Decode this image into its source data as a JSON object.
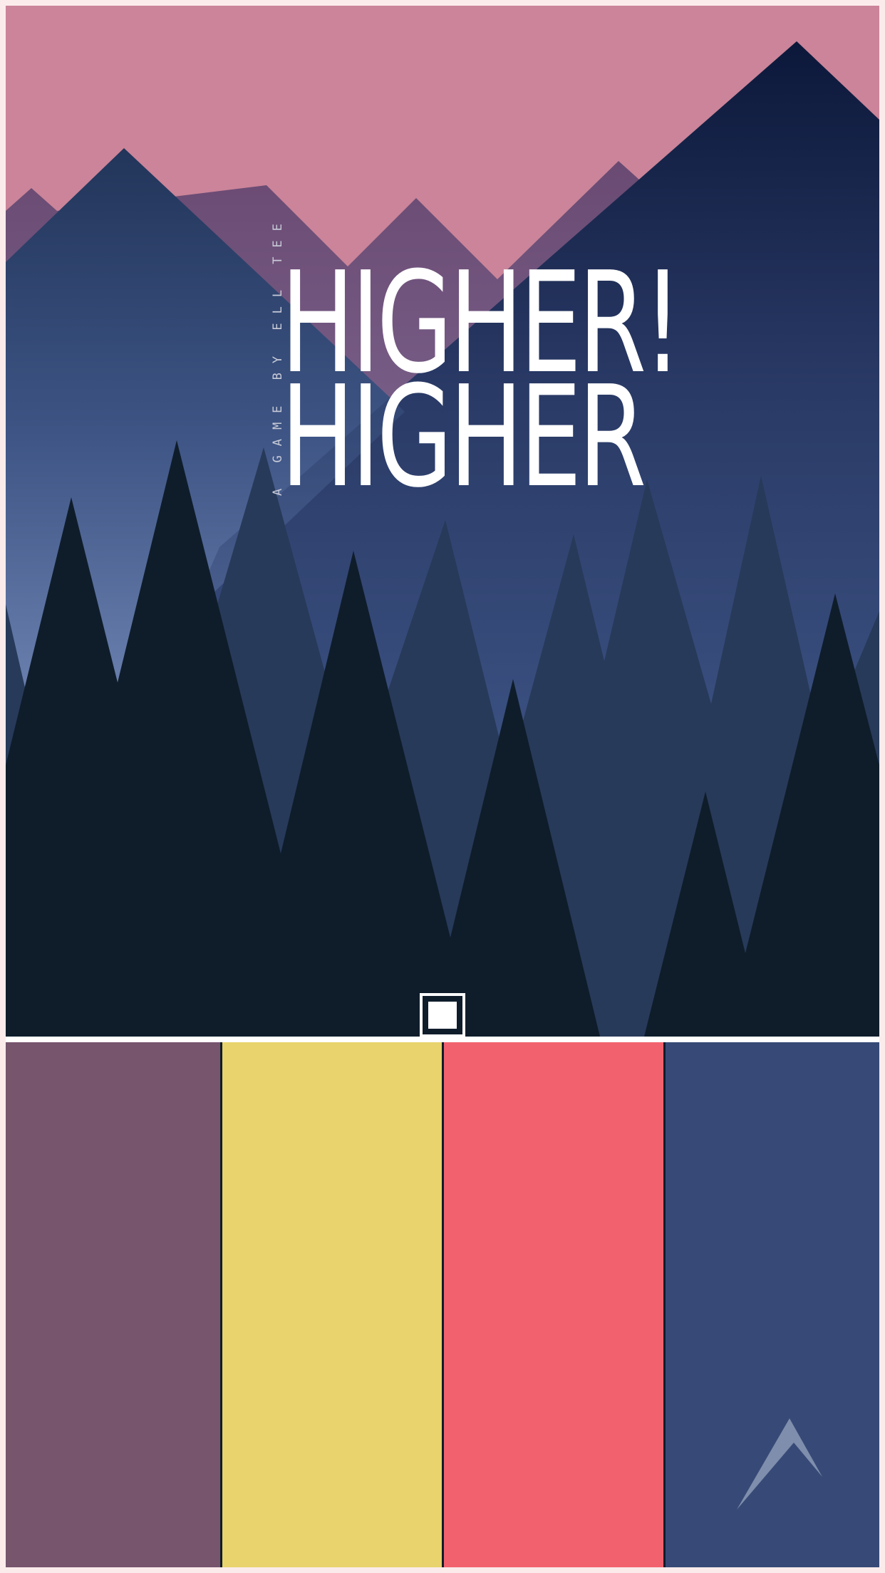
{
  "game": {
    "title_line1": "HIGHER!",
    "title_line2": "HIGHER",
    "byline": "A GAME BY ELL TEE"
  },
  "colors": {
    "sky_pink": "#cb8499",
    "mountain_navy": "#0d1a3c",
    "mountain_mauve": "#6c5075",
    "forest_dark": "#0f1d2b",
    "forest_mid": "#273a5a",
    "pad_1": "#77556d",
    "pad_2": "#e8d36d",
    "pad_3": "#f2626e",
    "pad_4": "#374a77"
  },
  "controls": {
    "pads": [
      "pad-1",
      "pad-2",
      "pad-3",
      "pad-4"
    ],
    "boost_icon": "chevron-up-icon"
  }
}
